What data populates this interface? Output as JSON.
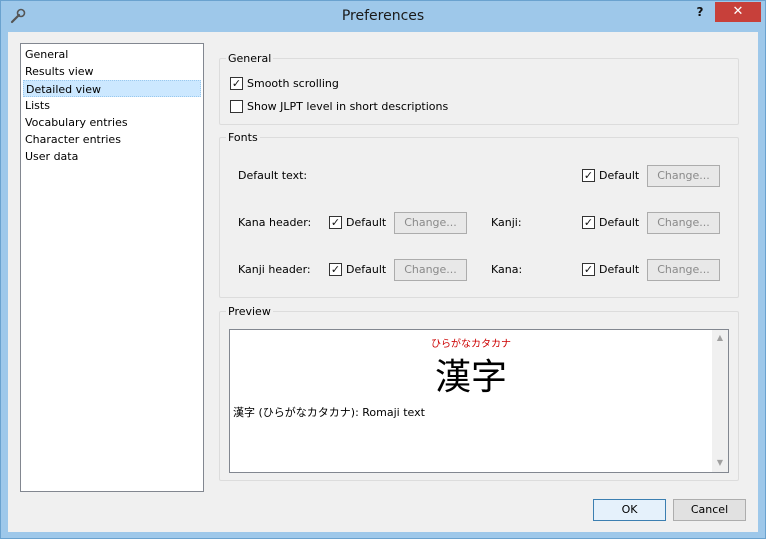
{
  "window": {
    "title": "Preferences",
    "help_label": "?",
    "close_label": "✕"
  },
  "nav": {
    "items": [
      {
        "label": "General"
      },
      {
        "label": "Results view"
      },
      {
        "label": "Detailed view"
      },
      {
        "label": "Lists"
      },
      {
        "label": "Vocabulary entries"
      },
      {
        "label": "Character entries"
      },
      {
        "label": "User data"
      }
    ],
    "selected": "Detailed view"
  },
  "general": {
    "title": "General",
    "smooth_scrolling": {
      "label": "Smooth scrolling",
      "checked": true
    },
    "show_jlpt": {
      "label": "Show JLPT level in short descriptions",
      "checked": false
    }
  },
  "fonts": {
    "title": "Fonts",
    "default_text_label": "Default text:",
    "kana_header_label": "Kana header:",
    "kanji_header_label": "Kanji header:",
    "kanji_label": "Kanji:",
    "kana_label": "Kana:",
    "default_label": "Default",
    "change_label": "Change...",
    "check_mark": "✓"
  },
  "preview": {
    "title": "Preview",
    "furigana": "ひらがなカタカナ",
    "kanji": "漢字",
    "line": "漢字 (ひらがなカタカナ): Romaji text"
  },
  "buttons": {
    "ok": "OK",
    "cancel": "Cancel"
  }
}
